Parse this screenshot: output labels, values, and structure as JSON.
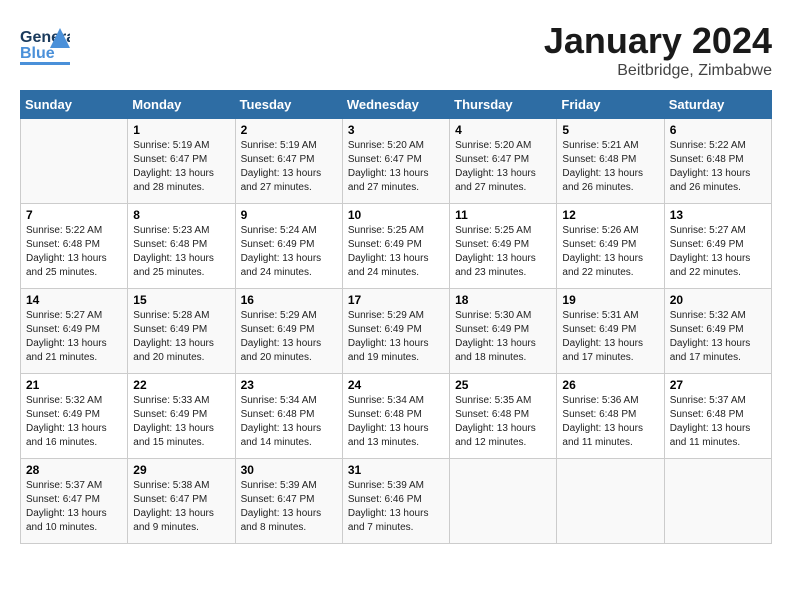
{
  "header": {
    "logo_general": "General",
    "logo_blue": "Blue",
    "month_title": "January 2024",
    "location": "Beitbridge, Zimbabwe"
  },
  "days_of_week": [
    "Sunday",
    "Monday",
    "Tuesday",
    "Wednesday",
    "Thursday",
    "Friday",
    "Saturday"
  ],
  "weeks": [
    [
      {
        "day": "",
        "sunrise": "",
        "sunset": "",
        "daylight": ""
      },
      {
        "day": "1",
        "sunrise": "Sunrise: 5:19 AM",
        "sunset": "Sunset: 6:47 PM",
        "daylight": "Daylight: 13 hours and 28 minutes."
      },
      {
        "day": "2",
        "sunrise": "Sunrise: 5:19 AM",
        "sunset": "Sunset: 6:47 PM",
        "daylight": "Daylight: 13 hours and 27 minutes."
      },
      {
        "day": "3",
        "sunrise": "Sunrise: 5:20 AM",
        "sunset": "Sunset: 6:47 PM",
        "daylight": "Daylight: 13 hours and 27 minutes."
      },
      {
        "day": "4",
        "sunrise": "Sunrise: 5:20 AM",
        "sunset": "Sunset: 6:47 PM",
        "daylight": "Daylight: 13 hours and 27 minutes."
      },
      {
        "day": "5",
        "sunrise": "Sunrise: 5:21 AM",
        "sunset": "Sunset: 6:48 PM",
        "daylight": "Daylight: 13 hours and 26 minutes."
      },
      {
        "day": "6",
        "sunrise": "Sunrise: 5:22 AM",
        "sunset": "Sunset: 6:48 PM",
        "daylight": "Daylight: 13 hours and 26 minutes."
      }
    ],
    [
      {
        "day": "7",
        "sunrise": "Sunrise: 5:22 AM",
        "sunset": "Sunset: 6:48 PM",
        "daylight": "Daylight: 13 hours and 25 minutes."
      },
      {
        "day": "8",
        "sunrise": "Sunrise: 5:23 AM",
        "sunset": "Sunset: 6:48 PM",
        "daylight": "Daylight: 13 hours and 25 minutes."
      },
      {
        "day": "9",
        "sunrise": "Sunrise: 5:24 AM",
        "sunset": "Sunset: 6:49 PM",
        "daylight": "Daylight: 13 hours and 24 minutes."
      },
      {
        "day": "10",
        "sunrise": "Sunrise: 5:25 AM",
        "sunset": "Sunset: 6:49 PM",
        "daylight": "Daylight: 13 hours and 24 minutes."
      },
      {
        "day": "11",
        "sunrise": "Sunrise: 5:25 AM",
        "sunset": "Sunset: 6:49 PM",
        "daylight": "Daylight: 13 hours and 23 minutes."
      },
      {
        "day": "12",
        "sunrise": "Sunrise: 5:26 AM",
        "sunset": "Sunset: 6:49 PM",
        "daylight": "Daylight: 13 hours and 22 minutes."
      },
      {
        "day": "13",
        "sunrise": "Sunrise: 5:27 AM",
        "sunset": "Sunset: 6:49 PM",
        "daylight": "Daylight: 13 hours and 22 minutes."
      }
    ],
    [
      {
        "day": "14",
        "sunrise": "Sunrise: 5:27 AM",
        "sunset": "Sunset: 6:49 PM",
        "daylight": "Daylight: 13 hours and 21 minutes."
      },
      {
        "day": "15",
        "sunrise": "Sunrise: 5:28 AM",
        "sunset": "Sunset: 6:49 PM",
        "daylight": "Daylight: 13 hours and 20 minutes."
      },
      {
        "day": "16",
        "sunrise": "Sunrise: 5:29 AM",
        "sunset": "Sunset: 6:49 PM",
        "daylight": "Daylight: 13 hours and 20 minutes."
      },
      {
        "day": "17",
        "sunrise": "Sunrise: 5:29 AM",
        "sunset": "Sunset: 6:49 PM",
        "daylight": "Daylight: 13 hours and 19 minutes."
      },
      {
        "day": "18",
        "sunrise": "Sunrise: 5:30 AM",
        "sunset": "Sunset: 6:49 PM",
        "daylight": "Daylight: 13 hours and 18 minutes."
      },
      {
        "day": "19",
        "sunrise": "Sunrise: 5:31 AM",
        "sunset": "Sunset: 6:49 PM",
        "daylight": "Daylight: 13 hours and 17 minutes."
      },
      {
        "day": "20",
        "sunrise": "Sunrise: 5:32 AM",
        "sunset": "Sunset: 6:49 PM",
        "daylight": "Daylight: 13 hours and 17 minutes."
      }
    ],
    [
      {
        "day": "21",
        "sunrise": "Sunrise: 5:32 AM",
        "sunset": "Sunset: 6:49 PM",
        "daylight": "Daylight: 13 hours and 16 minutes."
      },
      {
        "day": "22",
        "sunrise": "Sunrise: 5:33 AM",
        "sunset": "Sunset: 6:49 PM",
        "daylight": "Daylight: 13 hours and 15 minutes."
      },
      {
        "day": "23",
        "sunrise": "Sunrise: 5:34 AM",
        "sunset": "Sunset: 6:48 PM",
        "daylight": "Daylight: 13 hours and 14 minutes."
      },
      {
        "day": "24",
        "sunrise": "Sunrise: 5:34 AM",
        "sunset": "Sunset: 6:48 PM",
        "daylight": "Daylight: 13 hours and 13 minutes."
      },
      {
        "day": "25",
        "sunrise": "Sunrise: 5:35 AM",
        "sunset": "Sunset: 6:48 PM",
        "daylight": "Daylight: 13 hours and 12 minutes."
      },
      {
        "day": "26",
        "sunrise": "Sunrise: 5:36 AM",
        "sunset": "Sunset: 6:48 PM",
        "daylight": "Daylight: 13 hours and 11 minutes."
      },
      {
        "day": "27",
        "sunrise": "Sunrise: 5:37 AM",
        "sunset": "Sunset: 6:48 PM",
        "daylight": "Daylight: 13 hours and 11 minutes."
      }
    ],
    [
      {
        "day": "28",
        "sunrise": "Sunrise: 5:37 AM",
        "sunset": "Sunset: 6:47 PM",
        "daylight": "Daylight: 13 hours and 10 minutes."
      },
      {
        "day": "29",
        "sunrise": "Sunrise: 5:38 AM",
        "sunset": "Sunset: 6:47 PM",
        "daylight": "Daylight: 13 hours and 9 minutes."
      },
      {
        "day": "30",
        "sunrise": "Sunrise: 5:39 AM",
        "sunset": "Sunset: 6:47 PM",
        "daylight": "Daylight: 13 hours and 8 minutes."
      },
      {
        "day": "31",
        "sunrise": "Sunrise: 5:39 AM",
        "sunset": "Sunset: 6:46 PM",
        "daylight": "Daylight: 13 hours and 7 minutes."
      },
      {
        "day": "",
        "sunrise": "",
        "sunset": "",
        "daylight": ""
      },
      {
        "day": "",
        "sunrise": "",
        "sunset": "",
        "daylight": ""
      },
      {
        "day": "",
        "sunrise": "",
        "sunset": "",
        "daylight": ""
      }
    ]
  ]
}
